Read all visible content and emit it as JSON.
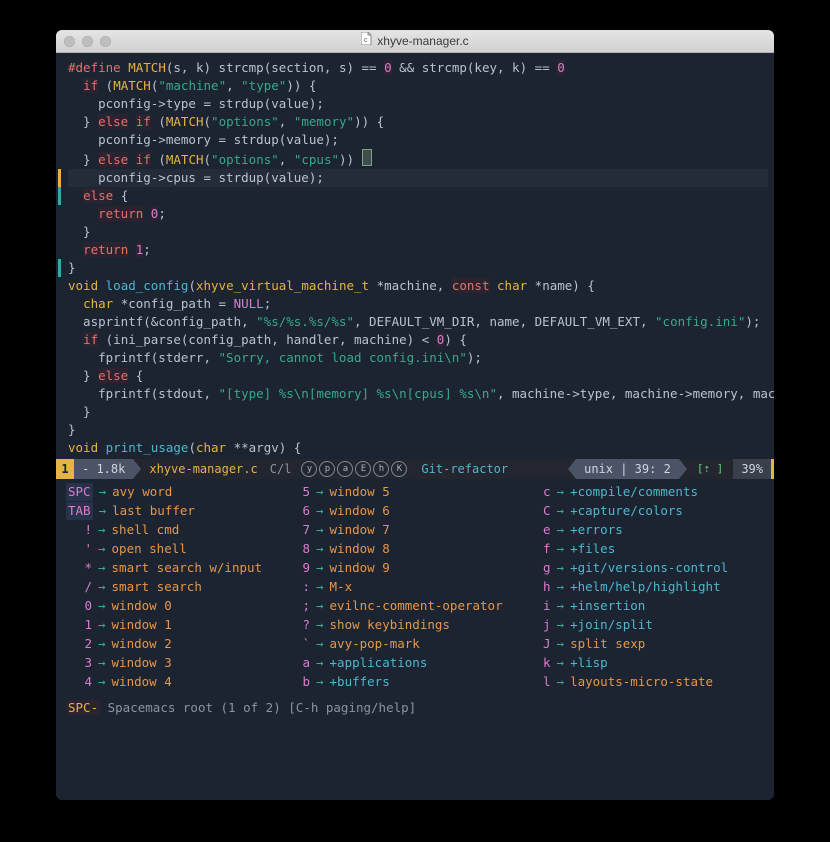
{
  "window": {
    "title": "xhyve-manager.c"
  },
  "modeline": {
    "state": "1",
    "size": "- 1.8k",
    "file": "xhyve-manager.c",
    "lang": "C/l",
    "flags": [
      "y",
      "p",
      "a",
      "E",
      "h",
      "K"
    ],
    "git": "Git-refactor",
    "enc": "unix | 39: 2",
    "arrows": "[⇡ ]",
    "pct": "39%"
  },
  "code": {
    "lines": [
      [
        [
          "c-pre",
          "#define"
        ],
        [
          "c-p",
          " "
        ],
        [
          "c-mac",
          "MATCH"
        ],
        [
          "c-p",
          "(s, k) strcmp(section, s) == "
        ],
        [
          "c-num bg-num",
          "0"
        ],
        [
          "c-p",
          " && strcmp(key, k) == "
        ],
        [
          "c-num bg-num",
          "0"
        ]
      ],
      [
        [
          "c-p",
          "  "
        ],
        [
          "c-key",
          "if"
        ],
        [
          "c-p",
          " ("
        ],
        [
          "c-mac",
          "MATCH"
        ],
        [
          "c-p",
          "("
        ],
        [
          "c-str",
          "\"machine\""
        ],
        [
          "c-p",
          ", "
        ],
        [
          "c-str",
          "\"type\""
        ],
        [
          "c-p",
          ")) {"
        ]
      ],
      [
        [
          "c-p",
          "    pconfig->type = strdup(value);"
        ]
      ],
      [
        [
          "c-p",
          "  } "
        ],
        [
          "c-key",
          "else"
        ],
        [
          "c-p",
          " "
        ],
        [
          "c-key",
          "if"
        ],
        [
          "c-p",
          " ("
        ],
        [
          "c-mac",
          "MATCH"
        ],
        [
          "c-p",
          "("
        ],
        [
          "c-str",
          "\"options\""
        ],
        [
          "c-p",
          ", "
        ],
        [
          "c-str",
          "\"memory\""
        ],
        [
          "c-p",
          ")) {"
        ]
      ],
      [
        [
          "c-p",
          "    pconfig->memory = strdup(value);"
        ]
      ],
      [
        [
          "c-p",
          "  } "
        ],
        [
          "c-key",
          "else"
        ],
        [
          "c-p",
          " "
        ],
        [
          "c-key",
          "if"
        ],
        [
          "c-p",
          " ("
        ],
        [
          "c-mac",
          "MATCH"
        ],
        [
          "c-p",
          "("
        ],
        [
          "c-str",
          "\"options\""
        ],
        [
          "c-p",
          ", "
        ],
        [
          "c-str",
          "\"cpus\""
        ],
        [
          "c-p",
          ")) "
        ],
        [
          "cursor",
          "{"
        ]
      ],
      [
        [
          "gut",
          "yellow"
        ],
        [
          "c-p",
          "    pconfig->cpus = strdup(value);"
        ]
      ],
      [
        [
          "gut",
          "teal"
        ],
        [
          "c-p",
          "  "
        ],
        [
          "c-key",
          "else"
        ],
        [
          "c-p",
          " {"
        ]
      ],
      [
        [
          "c-p",
          "    "
        ],
        [
          "c-key",
          "return"
        ],
        [
          "c-p",
          " "
        ],
        [
          "c-num bg-num",
          "0"
        ],
        [
          "c-p",
          ";"
        ]
      ],
      [
        [
          "c-p",
          "  }"
        ]
      ],
      [
        [
          "c-p",
          ""
        ]
      ],
      [
        [
          "c-p",
          "  "
        ],
        [
          "c-key",
          "return"
        ],
        [
          "c-p",
          " "
        ],
        [
          "c-num bg-num",
          "1"
        ],
        [
          "c-p",
          ";"
        ]
      ],
      [
        [
          "gut",
          "teal"
        ],
        [
          "c-p",
          "}"
        ]
      ],
      [
        [
          "c-p",
          ""
        ]
      ],
      [
        [
          "c-type",
          "void"
        ],
        [
          "c-p",
          " "
        ],
        [
          "c-fn",
          "load_config"
        ],
        [
          "c-p",
          "("
        ],
        [
          "c-type",
          "xhyve_virtual_machine_t"
        ],
        [
          "c-p",
          " *machine, "
        ],
        [
          "c-key",
          "const"
        ],
        [
          "c-p",
          " "
        ],
        [
          "c-type",
          "char"
        ],
        [
          "c-p",
          " *name) {"
        ]
      ],
      [
        [
          "c-p",
          "  "
        ],
        [
          "c-type",
          "char"
        ],
        [
          "c-p",
          " *config_path = "
        ],
        [
          "c-null",
          "NULL"
        ],
        [
          "c-p",
          ";"
        ]
      ],
      [
        [
          "c-p",
          "  asprintf(&config_path, "
        ],
        [
          "c-str",
          "\"%s/%s.%s/%s\""
        ],
        [
          "c-p",
          ", DEFAULT_VM_DIR, name, DEFAULT_VM_EXT, "
        ],
        [
          "c-str",
          "\"config.ini\""
        ],
        [
          "c-p",
          ");"
        ]
      ],
      [
        [
          "c-p",
          ""
        ]
      ],
      [
        [
          "c-p",
          "  "
        ],
        [
          "c-key",
          "if"
        ],
        [
          "c-p",
          " (ini_parse(config_path, handler, machine) < "
        ],
        [
          "c-num bg-num",
          "0"
        ],
        [
          "c-p",
          ") {"
        ]
      ],
      [
        [
          "c-p",
          "    fprintf(stderr, "
        ],
        [
          "c-str",
          "\"Sorry, cannot load config.ini\\n\""
        ],
        [
          "c-p",
          ");"
        ]
      ],
      [
        [
          "c-p",
          "  } "
        ],
        [
          "c-key",
          "else"
        ],
        [
          "c-p",
          " {"
        ]
      ],
      [
        [
          "c-p",
          "    fprintf(stdout, "
        ],
        [
          "c-str",
          "\"[type] %s\\n[memory] %s\\n[cpus] %s\\n\""
        ],
        [
          "c-p",
          ", machine->type, machine->memory, machine->cpus);"
        ]
      ],
      [
        [
          "c-p",
          "  }"
        ]
      ],
      [
        [
          "c-p",
          "}"
        ]
      ],
      [
        [
          "c-p",
          ""
        ]
      ],
      [
        [
          "c-type",
          "void"
        ],
        [
          "c-p",
          " "
        ],
        [
          "c-fn",
          "print_usage"
        ],
        [
          "c-p",
          "("
        ],
        [
          "c-type",
          "char"
        ],
        [
          "c-p",
          " **argv) {"
        ]
      ]
    ]
  },
  "whichkey": {
    "columns": [
      [
        {
          "key": "SPC",
          "bg": true,
          "label": "avy word",
          "group": false
        },
        {
          "key": "TAB",
          "bg": true,
          "label": "last buffer",
          "group": false
        },
        {
          "key": "!",
          "label": "shell cmd",
          "group": false
        },
        {
          "key": "'",
          "label": "open shell",
          "group": false
        },
        {
          "key": "*",
          "label": "smart search w/input",
          "group": false
        },
        {
          "key": "/",
          "label": "smart search",
          "group": false
        },
        {
          "key": "0",
          "label": "window 0",
          "group": false
        },
        {
          "key": "1",
          "label": "window 1",
          "group": false
        },
        {
          "key": "2",
          "label": "window 2",
          "group": false
        },
        {
          "key": "3",
          "label": "window 3",
          "group": false
        },
        {
          "key": "4",
          "label": "window 4",
          "group": false
        }
      ],
      [
        {
          "key": "5",
          "label": "window 5",
          "group": false
        },
        {
          "key": "6",
          "label": "window 6",
          "group": false
        },
        {
          "key": "7",
          "label": "window 7",
          "group": false
        },
        {
          "key": "8",
          "label": "window 8",
          "group": false
        },
        {
          "key": "9",
          "label": "window 9",
          "group": false
        },
        {
          "key": ":",
          "label": "M-x",
          "group": false
        },
        {
          "key": ";",
          "label": "evilnc-comment-operator",
          "group": false
        },
        {
          "key": "?",
          "label": "show keybindings",
          "group": false
        },
        {
          "key": "`",
          "label": "avy-pop-mark",
          "group": false
        },
        {
          "key": "a",
          "label": "+applications",
          "group": true
        },
        {
          "key": "b",
          "label": "+buffers",
          "group": true
        }
      ],
      [
        {
          "key": "c",
          "label": "+compile/comments",
          "group": true
        },
        {
          "key": "C",
          "label": "+capture/colors",
          "group": true
        },
        {
          "key": "e",
          "label": "+errors",
          "group": true
        },
        {
          "key": "f",
          "label": "+files",
          "group": true
        },
        {
          "key": "g",
          "label": "+git/versions-control",
          "group": true
        },
        {
          "key": "h",
          "label": "+helm/help/highlight",
          "group": true
        },
        {
          "key": "i",
          "label": "+insertion",
          "group": true
        },
        {
          "key": "j",
          "label": "+join/split",
          "group": true
        },
        {
          "key": "J",
          "label": "split sexp",
          "group": false
        },
        {
          "key": "k",
          "label": "+lisp",
          "group": true
        },
        {
          "key": "l",
          "label": "layouts-micro-state",
          "group": false
        }
      ]
    ]
  },
  "minibuffer": {
    "prefix": "SPC-",
    "rest": " Spacemacs root (1 of 2) [C-h paging/help]"
  }
}
